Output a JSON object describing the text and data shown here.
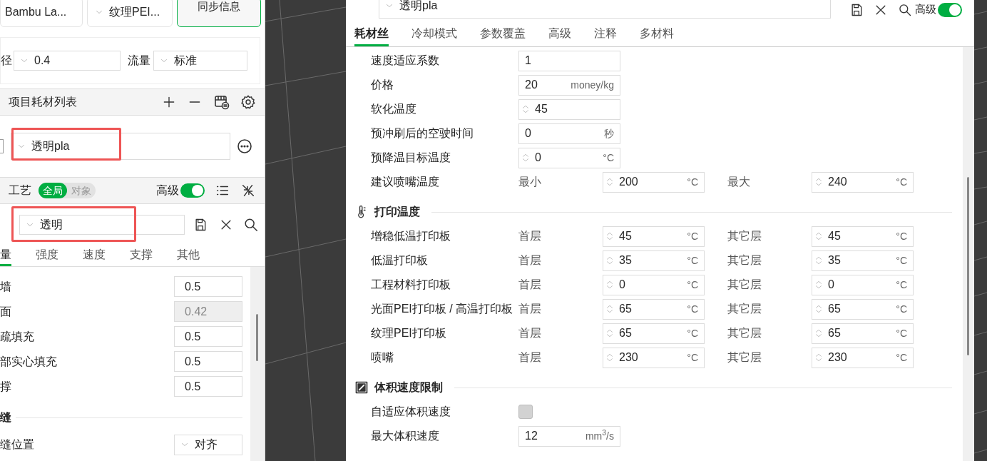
{
  "left_panel": {
    "top_buttons": [
      {
        "kind": "card",
        "label": "Bambu La..."
      },
      {
        "kind": "dropdown",
        "label": "纹理PEI..."
      },
      {
        "kind": "sync",
        "label": "同步信息"
      }
    ],
    "nozzle": {
      "diameter_label": "径",
      "diameter": "0.4",
      "flow_label": "流量",
      "flow": "标准"
    },
    "filament_list": {
      "title": "项目耗材列表",
      "preset": "透明pla",
      "highlighted": true
    },
    "process": {
      "title": "工艺",
      "scope": [
        {
          "label": "全局",
          "selected": true
        },
        {
          "label": "对象",
          "selected": false
        }
      ],
      "advanced_label": "高级",
      "advanced_on": true,
      "preset": "透明",
      "highlighted": true
    },
    "tabs": [
      {
        "label": "量",
        "selected": true
      },
      {
        "label": "强度",
        "selected": false
      },
      {
        "label": "速度",
        "selected": false
      },
      {
        "label": "支撑",
        "selected": false
      },
      {
        "label": "其他",
        "selected": false
      }
    ],
    "settings": [
      {
        "label": "墙",
        "value": "0.5",
        "disabled": false
      },
      {
        "label": "面",
        "value": "0.42",
        "disabled": true
      },
      {
        "label": "疏填充",
        "value": "0.5",
        "disabled": false
      },
      {
        "label": "部实心填充",
        "value": "0.5",
        "disabled": false
      },
      {
        "label": "撑",
        "value": "0.5",
        "disabled": false
      }
    ],
    "section": "缝",
    "seam": {
      "label": "缝位置",
      "value": "对齐"
    }
  },
  "filament_dialog": {
    "preset": "透明pla",
    "advanced_label": "高级",
    "advanced_on": true,
    "tabs": [
      {
        "label": "耗材丝",
        "selected": true
      },
      {
        "label": "冷却模式",
        "selected": false
      },
      {
        "label": "参数覆盖",
        "selected": false
      },
      {
        "label": "高级",
        "selected": false
      },
      {
        "label": "注释",
        "selected": false
      },
      {
        "label": "多材料",
        "selected": false
      }
    ],
    "rows": [
      {
        "kind": "fields",
        "label": "速度适应系数",
        "fields": [
          {
            "value": "1",
            "spinner": false
          }
        ]
      },
      {
        "kind": "fields",
        "label": "价格",
        "fields": [
          {
            "value": "20",
            "unit": "money/kg",
            "spinner": false
          }
        ]
      },
      {
        "kind": "fields",
        "label": "软化温度",
        "fields": [
          {
            "value": "45",
            "spinner": true
          }
        ]
      },
      {
        "kind": "fields",
        "label": "预冲刷后的空驶时间",
        "fields": [
          {
            "value": "0",
            "unit": "秒",
            "spinner": false
          }
        ]
      },
      {
        "kind": "fields",
        "label": "预降温目标温度",
        "fields": [
          {
            "value": "0",
            "unit": "°C",
            "spinner": true
          }
        ]
      },
      {
        "kind": "fields",
        "label": "建议喷嘴温度",
        "fields": [
          {
            "caption": "最小",
            "value": "200",
            "unit": "°C",
            "spinner": true
          },
          {
            "caption": "最大",
            "value": "240",
            "unit": "°C",
            "spinner": true
          }
        ]
      }
    ],
    "sections": [
      {
        "title": "打印温度",
        "rows": [
          {
            "kind": "fields",
            "label": "增稳低温打印板",
            "fields": [
              {
                "caption": "首层",
                "value": "45",
                "unit": "°C",
                "spinner": true
              },
              {
                "caption": "其它层",
                "value": "45",
                "unit": "°C",
                "spinner": true
              }
            ]
          },
          {
            "kind": "fields",
            "label": "低温打印板",
            "fields": [
              {
                "caption": "首层",
                "value": "35",
                "unit": "°C",
                "spinner": true
              },
              {
                "caption": "其它层",
                "value": "35",
                "unit": "°C",
                "spinner": true
              }
            ]
          },
          {
            "kind": "fields",
            "label": "工程材料打印板",
            "fields": [
              {
                "caption": "首层",
                "value": "0",
                "unit": "°C",
                "spinner": true
              },
              {
                "caption": "其它层",
                "value": "0",
                "unit": "°C",
                "spinner": true
              }
            ]
          },
          {
            "kind": "fields",
            "label": "光面PEI打印板 / 高温打印板",
            "fields": [
              {
                "caption": "首层",
                "value": "65",
                "unit": "°C",
                "spinner": true
              },
              {
                "caption": "其它层",
                "value": "65",
                "unit": "°C",
                "spinner": true
              }
            ]
          },
          {
            "kind": "fields",
            "label": "纹理PEI打印板",
            "fields": [
              {
                "caption": "首层",
                "value": "65",
                "unit": "°C",
                "spinner": true
              },
              {
                "caption": "其它层",
                "value": "65",
                "unit": "°C",
                "spinner": true
              }
            ]
          },
          {
            "kind": "fields",
            "label": "喷嘴",
            "fields": [
              {
                "caption": "首层",
                "value": "230",
                "unit": "°C",
                "spinner": true
              },
              {
                "caption": "其它层",
                "value": "230",
                "unit": "°C",
                "spinner": true
              }
            ]
          }
        ]
      },
      {
        "title": "体积速度限制",
        "rows": [
          {
            "kind": "checkbox",
            "label": "自适应体积速度",
            "checked": false
          },
          {
            "kind": "fields",
            "label": "最大体积速度",
            "fields": [
              {
                "value": "12",
                "unit": "mm$^{3}$/s",
                "spinner": false
              }
            ]
          }
        ]
      }
    ]
  }
}
